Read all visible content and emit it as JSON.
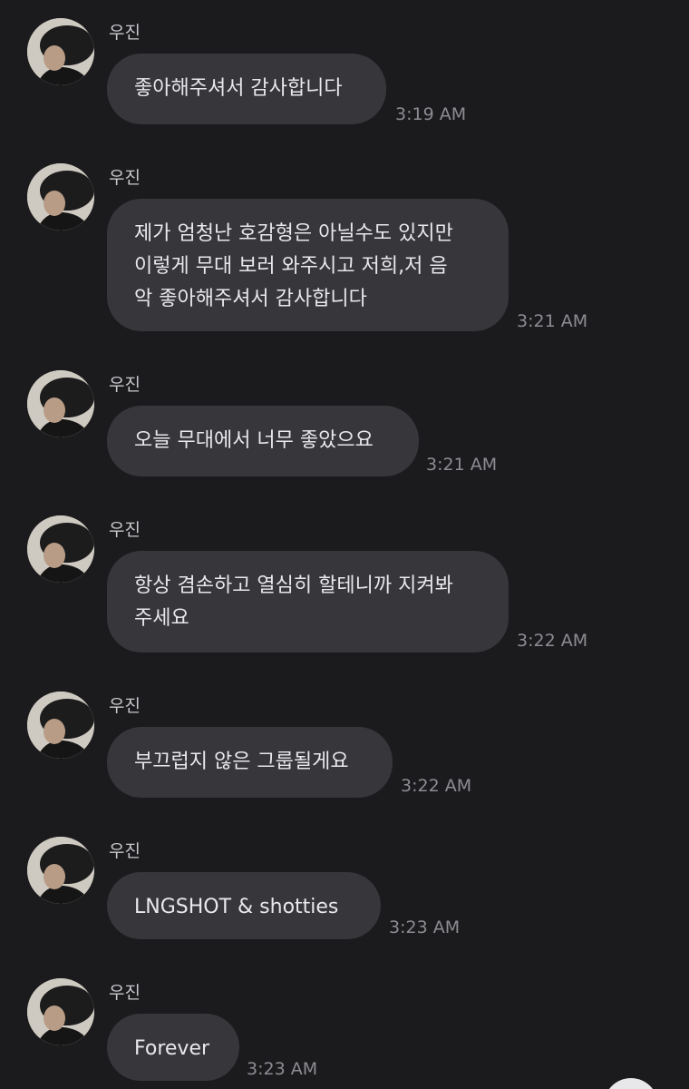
{
  "sender_name": "우진",
  "messages": [
    {
      "text": "좋아해주셔서 감사합니다",
      "time": "3:19 AM"
    },
    {
      "text": "제가 엄청난 호감형은 아닐수도 있지만\n이렇게 무대 보러 와주시고 저희,저 음\n악 좋아해주셔서 감사합니다",
      "time": "3:21 AM"
    },
    {
      "text": "오늘 무대에서 너무 좋았으요",
      "time": "3:21 AM"
    },
    {
      "text": "항상 겸손하고 열심히 할테니까 지켜봐\n주세요",
      "time": "3:22 AM"
    },
    {
      "text": "부끄럽지 않은 그룹될게요",
      "time": "3:22 AM"
    },
    {
      "text": "LNGSHOT & shotties",
      "time": "3:23 AM"
    },
    {
      "text": "Forever",
      "time": "3:23 AM"
    }
  ]
}
